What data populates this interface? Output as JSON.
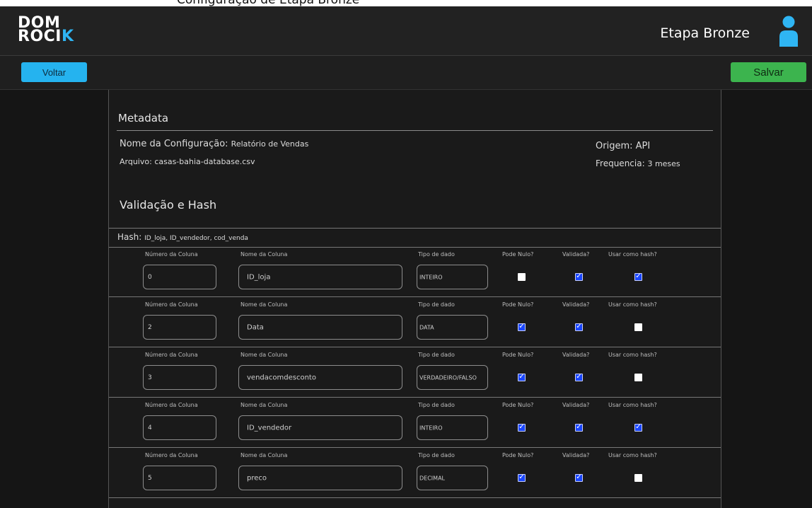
{
  "page_title": "Configuração de Etapa Bronze",
  "header": {
    "logo_line1": "DOM",
    "logo_line2": "ROCI",
    "logo_accent": "K",
    "stage": "Etapa Bronze",
    "user_icon": "user-icon",
    "accent": "#2fb5f3"
  },
  "toolbar": {
    "back_label": "Voltar",
    "save_label": "Salvar",
    "back_color": "#25b3ef",
    "save_color": "#3cb44e"
  },
  "metadata": {
    "title": "Metadata",
    "config_label": "Nome da Configuração:",
    "config_value": "Relatório de Vendas",
    "file_label": "Arquivo:",
    "file_value": "casas-bahia-database.csv",
    "origin_label": "Origem:",
    "origin_value": "API",
    "frequency_label": "Frequencia:",
    "frequency_value": "3 meses"
  },
  "validation": {
    "title": "Validação e Hash",
    "hash_label": "Hash:",
    "hash_value": "ID_loja, ID_vendedor, cod_venda"
  },
  "column_headers": {
    "number": "Número da Coluna",
    "name": "Nome da Coluna",
    "type": "Tipo de dado",
    "nullable": "Pode Nulo?",
    "validated": "Validada?",
    "use_hash": "Usar como hash?"
  },
  "rows": [
    {
      "number": "0",
      "name": "ID_loja",
      "type": "INTEIRO",
      "nullable": false,
      "validated": true,
      "use_hash": true
    },
    {
      "number": "2",
      "name": "Data",
      "type": "DATA",
      "nullable": true,
      "validated": true,
      "use_hash": false
    },
    {
      "number": "3",
      "name": "vendacomdesconto",
      "type": "VERDADEIRO/FALSO",
      "nullable": true,
      "validated": true,
      "use_hash": false
    },
    {
      "number": "4",
      "name": "ID_vendedor",
      "type": "INTEIRO",
      "nullable": true,
      "validated": true,
      "use_hash": true
    },
    {
      "number": "5",
      "name": "preco",
      "type": "DECIMAL",
      "nullable": true,
      "validated": true,
      "use_hash": false
    }
  ]
}
